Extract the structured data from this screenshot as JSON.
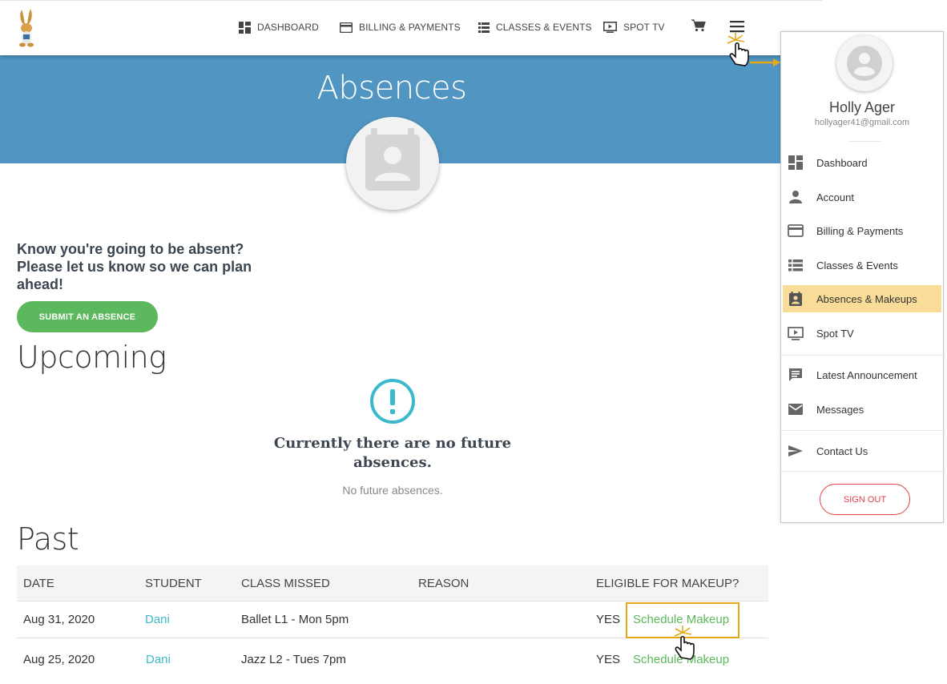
{
  "nav": {
    "dashboard": "DASHBOARD",
    "billing": "BILLING & PAYMENTS",
    "classes": "CLASSES & EVENTS",
    "spottv": "SPOT TV"
  },
  "banner": {
    "title": "Absences"
  },
  "intro": {
    "text": "Know you're going to be absent? Please let us know so we can plan ahead!"
  },
  "submit_button": "SUBMIT AN ABSENCE",
  "upcoming": {
    "title": "Upcoming",
    "empty_title": "Currently there are no future absences.",
    "empty_sub": "No future absences."
  },
  "past": {
    "title": "Past",
    "columns": [
      "DATE",
      "STUDENT",
      "CLASS MISSED",
      "REASON",
      "ELIGIBLE FOR MAKEUP?"
    ],
    "rows": [
      {
        "date": "Aug 31, 2020",
        "student": "Dani",
        "class": "Ballet L1 - Mon 5pm",
        "reason": "",
        "eligible": "YES",
        "action": "Schedule Makeup"
      },
      {
        "date": "Aug 25, 2020",
        "student": "Dani",
        "class": "Jazz L2 - Tues 7pm",
        "reason": "",
        "eligible": "YES",
        "action": "Schedule Makeup"
      }
    ]
  },
  "menu": {
    "name": "Holly Ager",
    "email": "hollyager41@gmail.com",
    "items": [
      {
        "label": "Dashboard",
        "icon": "dashboard-icon"
      },
      {
        "label": "Account",
        "icon": "person-icon"
      },
      {
        "label": "Billing & Payments",
        "icon": "credit-card-icon"
      },
      {
        "label": "Classes & Events",
        "icon": "list-icon"
      },
      {
        "label": "Absences & Makeups",
        "icon": "calendar-person-icon",
        "active": true
      },
      {
        "label": "Spot TV",
        "icon": "tv-play-icon"
      },
      {
        "label": "Latest Announcement",
        "icon": "announcement-icon"
      },
      {
        "label": "Messages",
        "icon": "mail-icon"
      },
      {
        "label": "Contact Us",
        "icon": "send-icon"
      }
    ],
    "signout": "SIGN OUT"
  },
  "colors": {
    "banner": "#5196c2",
    "primary_green": "#5cb85c",
    "link_teal": "#3fb8c8",
    "active_highlight": "#f8dc98",
    "callout_gold": "#e6a817",
    "signout_red": "#e24043"
  }
}
